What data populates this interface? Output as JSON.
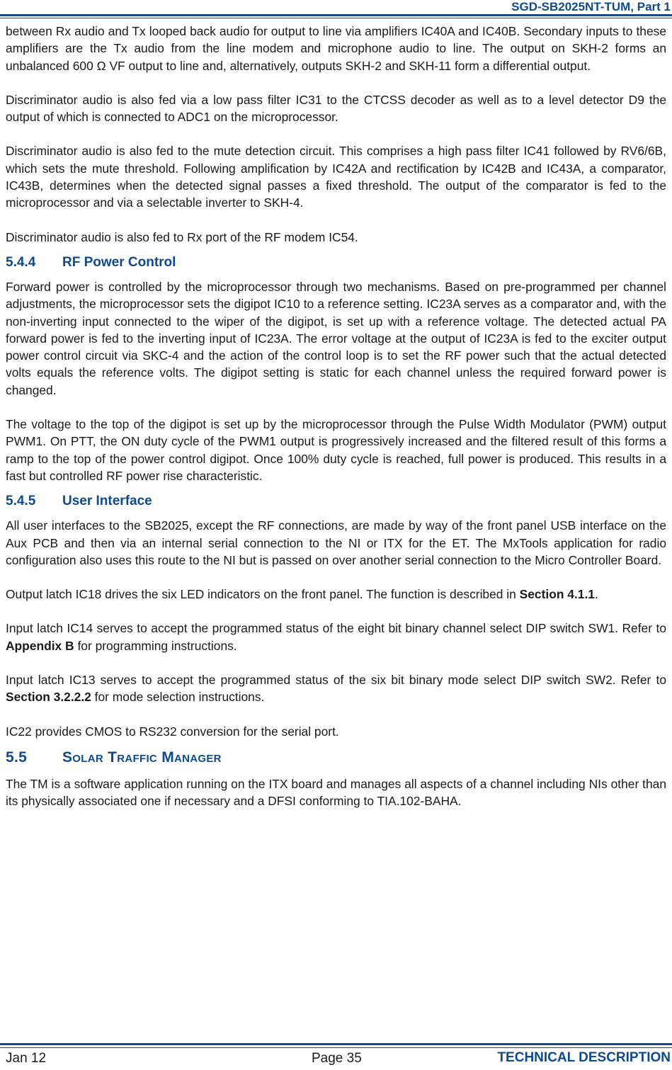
{
  "header": {
    "doc_title": "SGD-SB2025NT-TUM, Part 1"
  },
  "blocks": {
    "p1": "between Rx audio and Tx looped back audio for output to line via amplifiers IC40A and IC40B. Secondary inputs to these amplifiers are the Tx audio from the line modem and microphone audio to line.  The output on SKH-2 forms an unbalanced 600 Ω VF output to line and, alternatively, outputs SKH-2 and SKH-11 form a differential output.",
    "p2": "Discriminator audio is also fed via a low pass filter IC31 to the CTCSS decoder as well as to a level detector D9 the output of which is connected to ADC1 on the microprocessor.",
    "p3": "Discriminator audio is also fed to the mute detection circuit.  This comprises a high pass filter IC41 followed by RV6/6B, which sets the mute threshold.  Following amplification by IC42A and rectification by IC42B and IC43A, a comparator, IC43B, determines when the detected signal passes a fixed threshold.  The output of the comparator is fed to the microprocessor and via a selectable inverter to SKH-4.",
    "p4": "Discriminator audio is also fed to Rx port of the RF modem IC54.",
    "h544_num": "5.4.4",
    "h544_title": "RF Power Control",
    "p5": "Forward power is controlled by the microprocessor through two mechanisms.  Based on pre-programmed per channel adjustments, the microprocessor sets the digipot IC10 to a reference setting.  IC23A serves as a comparator and, with the non-inverting input connected to the wiper of the digipot, is set up with a reference voltage.  The detected actual PA forward power is fed to the inverting input of IC23A.  The error voltage at the output of IC23A is fed to the exciter output power control circuit via SKC-4 and the action of the control loop is to set the RF power such that the actual detected volts equals the reference volts.  The digipot setting is static for each channel unless the required forward power is changed.",
    "p6": "The voltage to the top of the digipot is set up by the microprocessor through the Pulse Width Modulator (PWM) output PWM1.  On PTT, the ON duty cycle of the PWM1 output is progressively increased and the filtered result of this forms a ramp to the top of the power control digipot.  Once 100% duty cycle is reached, full power is produced.  This results in a fast but controlled RF power rise characteristic.",
    "h545_num": "5.4.5",
    "h545_title": "User Interface",
    "p7": "All user interfaces to the SB2025, except the RF connections, are made by way of the front panel USB interface on the Aux PCB and then via an internal serial connection to the NI or ITX for the ET.  The MxTools application for radio configuration also uses this route to the NI but is passed on over another serial connection to the Micro Controller Board.",
    "p8_pre": "Output latch IC18 drives the six LED indicators on the front panel.  The function is described in ",
    "p8_link": "Section 4.1.1",
    "p8_post": ".",
    "p9_pre": "Input latch IC14 serves to accept the programmed status of the eight bit binary channel select DIP switch SW1.  Refer to ",
    "p9_link": "Appendix B",
    "p9_post": " for programming instructions.",
    "p10_pre": "Input latch IC13 serves to accept the programmed status of the six bit binary mode select DIP switch SW2.  Refer to ",
    "p10_link": "Section 3.2.2.2",
    "p10_post": " for mode selection instructions.",
    "p11": "IC22 provides CMOS to RS232 conversion for the serial port.",
    "h55_num": "5.5",
    "h55_title": "Solar Traffic Manager",
    "p12": "The TM is a software application running on the ITX board and manages all aspects of a channel including NIs other than its physically associated one if necessary and a DFSI conforming to TIA.102-BAHA."
  },
  "footer": {
    "date": "Jan 12",
    "page": "Page 35",
    "section": "TECHNICAL DESCRIPTION"
  }
}
